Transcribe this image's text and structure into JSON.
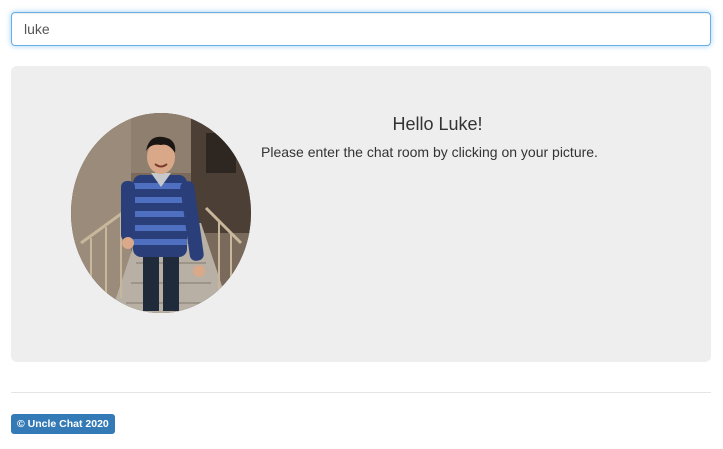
{
  "name_input": {
    "value": "luke"
  },
  "welcome": {
    "greeting": "Hello Luke!",
    "instruction": "Please enter the chat room by clicking on your picture."
  },
  "avatar": {
    "description_icon": "profile-photo"
  },
  "footer": {
    "badge": "© Uncle Chat 2020"
  },
  "colors": {
    "accent": "#337ab7",
    "panel": "#eeeeee",
    "focus_border": "#66afe9"
  }
}
